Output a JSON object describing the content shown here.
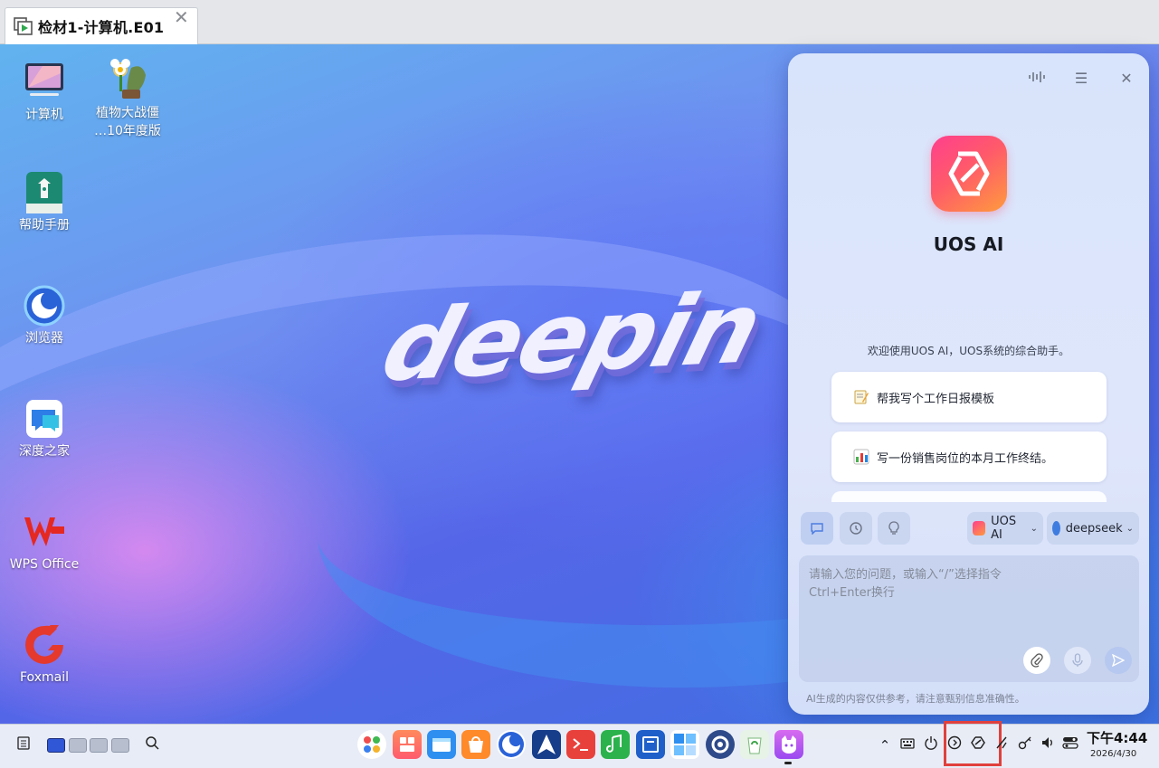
{
  "vm_tab": {
    "title": "检材1-计算机.E01",
    "close": "✕"
  },
  "desktop": {
    "wallpaper_text": "deepin",
    "icons": [
      {
        "label": "计算机",
        "icon": "computer-icon"
      },
      {
        "label": "植物大战僵\n…10年度版",
        "icon": "plants-vs-zombies-icon"
      },
      {
        "label": "帮助手册",
        "icon": "help-manual-icon"
      },
      {
        "label": "浏览器",
        "icon": "browser-icon"
      },
      {
        "label": "深度之家",
        "icon": "deepin-home-icon"
      },
      {
        "label": "WPS Office",
        "icon": "wps-office-icon"
      },
      {
        "label": "Foxmail",
        "icon": "foxmail-icon"
      }
    ]
  },
  "ai_panel": {
    "name": "UOS AI",
    "welcome": "欢迎使用UOS AI，UOS系统的综合助手。",
    "suggestions": [
      {
        "text": "帮我写个工作日报模板",
        "icon": "memo-icon"
      },
      {
        "text": "写一份销售岗位的本月工作终结。",
        "icon": "bar-chart-icon"
      }
    ],
    "assistant_select": "UOS AI",
    "model_select": "deepseek",
    "input_placeholder_line1": "请输入您的问题，或输入“/”选择指令",
    "input_placeholder_line2": "Ctrl+Enter换行",
    "footer": "AI生成的内容仅供参考，请注意甄别信息准确性。"
  },
  "taskbar": {
    "time": "下午4:44",
    "date": "2026/4/30",
    "apps": [
      "launcher",
      "app-store",
      "file-manager",
      "deepin-store",
      "browser",
      "deepin-draw",
      "terminal",
      "music",
      "deepin-writer",
      "multitasking",
      "control-center",
      "trash",
      "uos-ai"
    ],
    "tray": [
      "chevron-up-icon",
      "keyboard-icon",
      "power-icon",
      "notification-icon",
      "uos-ai-tray-icon",
      "network-icon",
      "key-icon",
      "volume-icon",
      "system-icon"
    ]
  },
  "colors": {
    "accent": "#4c7ce0",
    "highlight_box": "#e0403d",
    "ai_gradient_start": "#ff3f8e",
    "ai_gradient_end": "#ff9a3d"
  }
}
